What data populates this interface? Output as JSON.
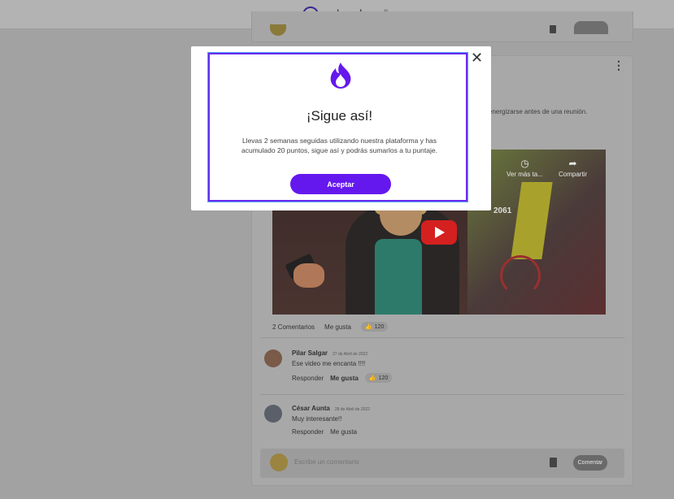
{
  "header": {
    "logo_text": "zalvadora",
    "logo_mark": "®"
  },
  "post": {
    "text_fragment": "energizarse antes de una reunión.",
    "video": {
      "later_label": "Ver más ta...",
      "share_label": "Compartir",
      "sign_number": "2061"
    },
    "stats": {
      "comments_label": "2 Comentarios",
      "like_label": "Me gusta",
      "like_count": "120"
    }
  },
  "comments": [
    {
      "author": "Pilar Salgar",
      "date": "27 de Abril de 2022",
      "text": "Ese video me encanta !!!!",
      "reply_label": "Responder",
      "like_label": "Me gusta",
      "like_count": "120"
    },
    {
      "author": "César Aunta",
      "date": "28 de Abril de 2022",
      "text": "Muy interesante!!",
      "reply_label": "Responder",
      "like_label": "Me gusta"
    }
  ],
  "composer": {
    "placeholder": "Escribe un comentario",
    "submit_label": "Comentar"
  },
  "modal": {
    "title": "¡Sigue así!",
    "message": "Llevas 2 semanas seguidas utilizando nuestra plataforma y has acumulado 20 puntos, sigue así y podrás sumarlos a tu puntaje.",
    "accept_label": "Aceptar",
    "close_glyph": "✕",
    "icon": "flame-icon",
    "accent_color": "#6518ee"
  }
}
